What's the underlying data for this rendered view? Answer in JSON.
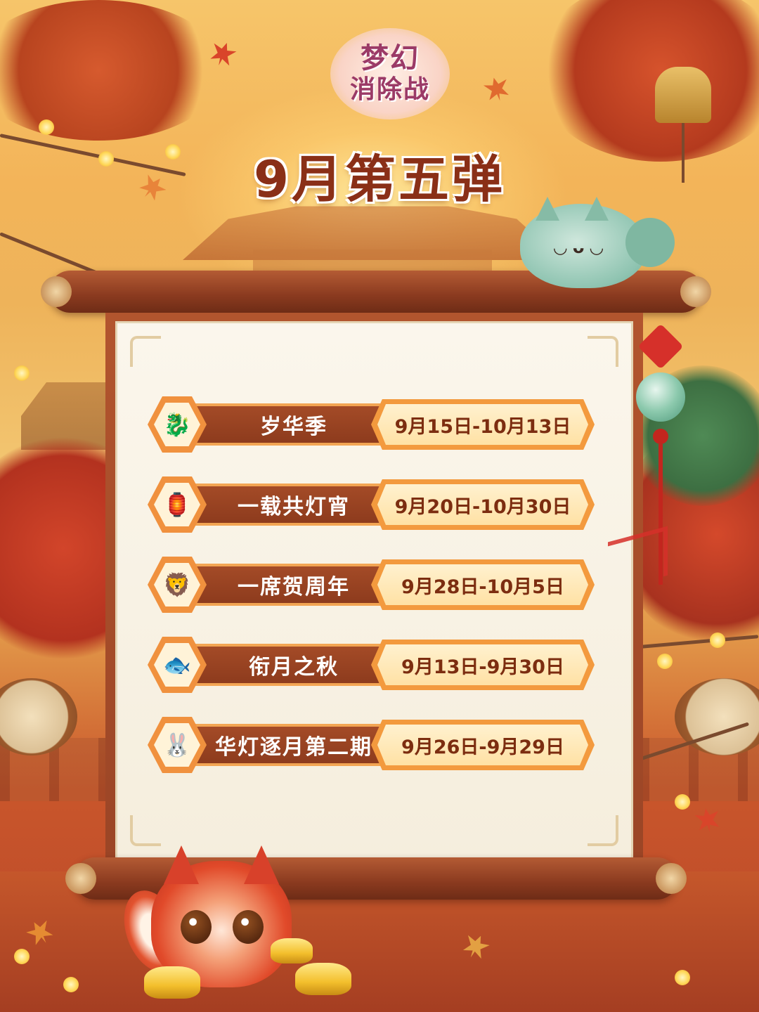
{
  "logo": {
    "line1": "梦幻",
    "line2": "消除战"
  },
  "title": "9月第五弹",
  "events": [
    {
      "name": "岁华季",
      "date": "9月15日-10月13日",
      "icon": "🐉"
    },
    {
      "name": "一载共灯宵",
      "date": "9月20日-10月30日",
      "icon": "🏮"
    },
    {
      "name": "一席贺周年",
      "date": "9月28日-10月5日",
      "icon": "🦁"
    },
    {
      "name": "衔月之秋",
      "date": "9月13日-9月30日",
      "icon": "🐟"
    },
    {
      "name": "华灯逐月第二期",
      "date": "9月26日-9月29日",
      "icon": "🐰"
    }
  ],
  "colors": {
    "title": "#8a2f17",
    "scroll_wood": "#9b4526",
    "paper": "#fbf6ec",
    "date_frame": "#f39a3e",
    "date_text": "#7c2d10",
    "name_bar": "#a44b27"
  }
}
